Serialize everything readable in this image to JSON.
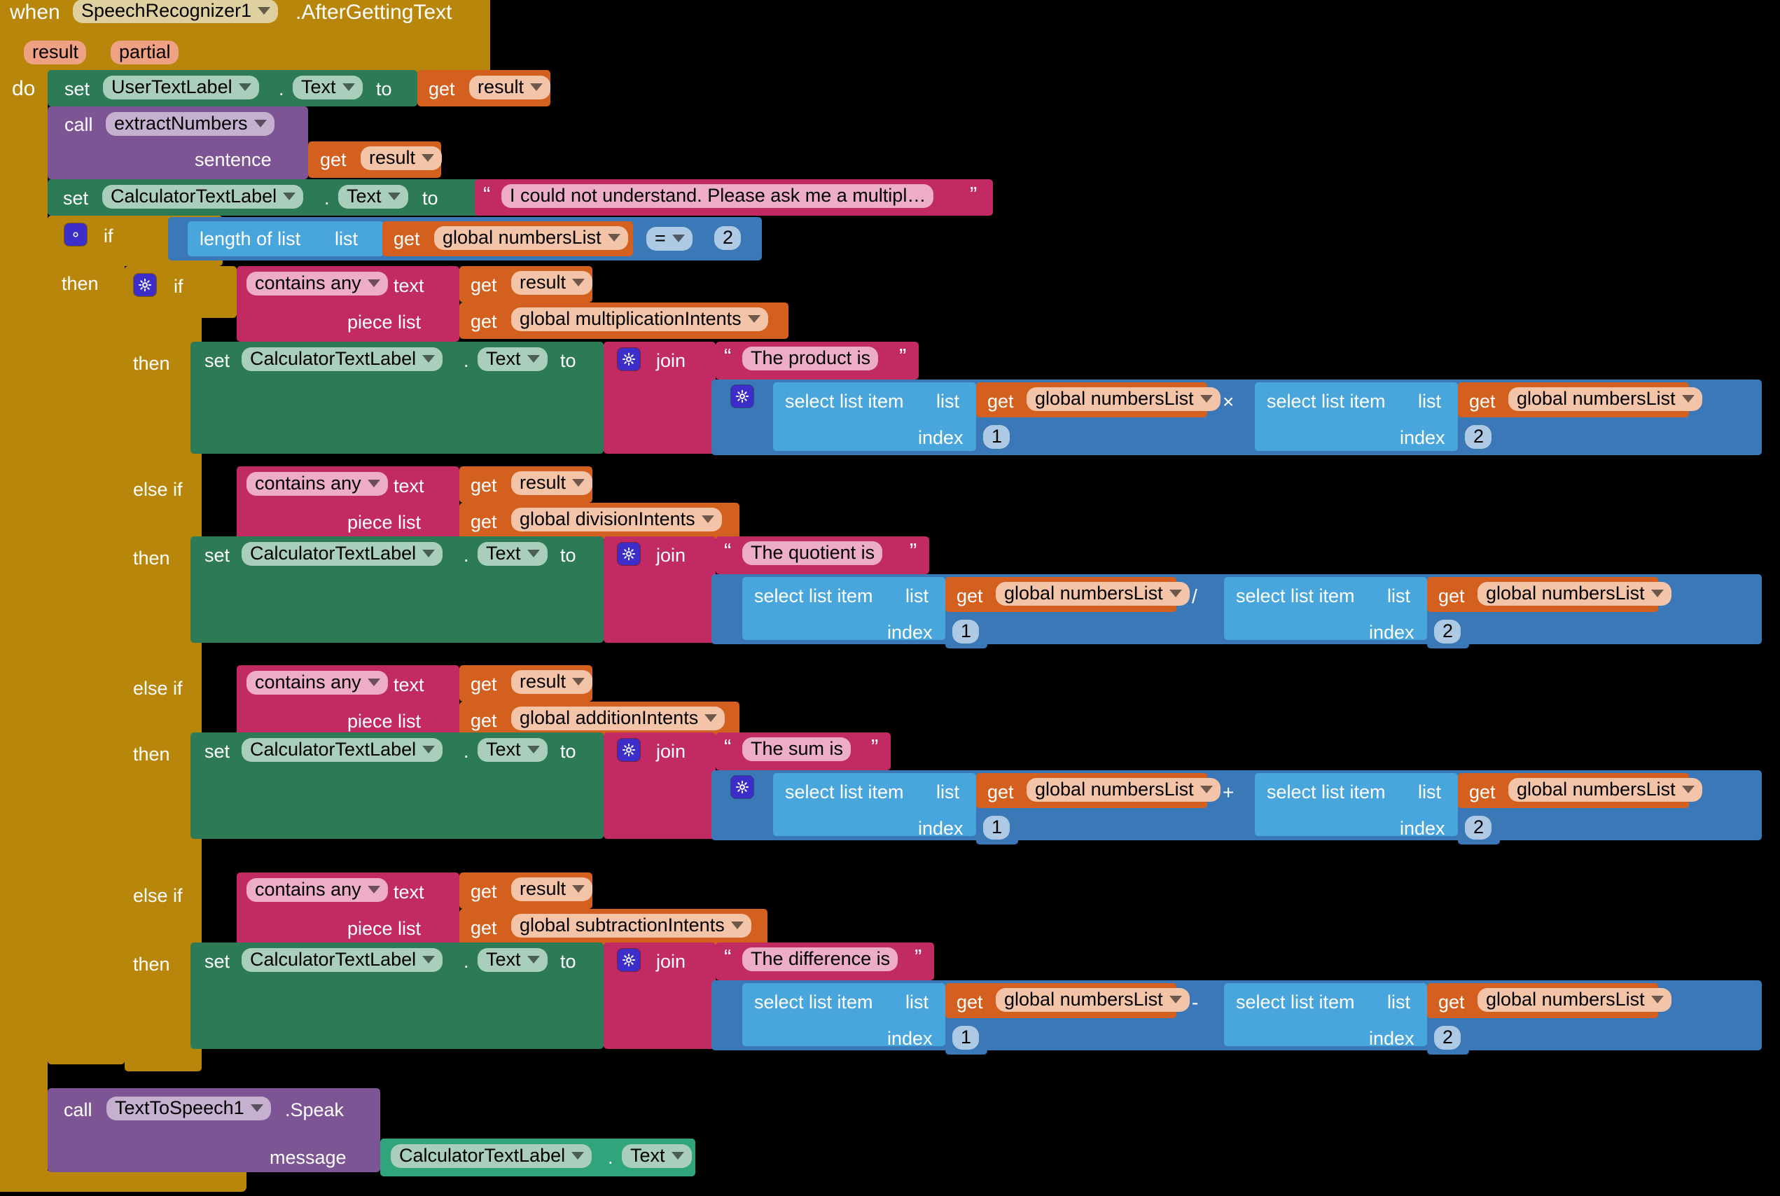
{
  "app": "MIT App Inventor Blocks Editor",
  "event": {
    "when": "when",
    "component": "SpeechRecognizer1",
    "method": ".AfterGettingText",
    "params": [
      "result",
      "partial"
    ],
    "do_label": "do"
  },
  "statements": {
    "set_label": "set",
    "call_label": "call",
    "to_label": "to",
    "dot": ".",
    "get_label": "get",
    "user_text_label": "UserTextLabel",
    "calculator_text_label": "CalculatorTextLabel",
    "text_prop": "Text",
    "proc_name": "extractNumbers",
    "sentence_label": "sentence",
    "result_var": "result",
    "tts_component": "TextToSpeech1",
    "tts_method": ".Speak",
    "message_label": "message"
  },
  "fallback_text": "I could not understand.  Please ask me a multipl…",
  "control": {
    "if": "if",
    "then": "then",
    "else_if": "else if"
  },
  "outer_condition": {
    "length_of_list": "length of list",
    "list_label": "list",
    "variable": "global numbersList",
    "operator": "=",
    "value": "2"
  },
  "list_ops": {
    "select": "select list item",
    "list_label": "list",
    "index_label": "index",
    "numbers_list": "global numbersList"
  },
  "text_ops": {
    "contains_any": "contains any",
    "text_label": "text",
    "piece_list_label": "piece list",
    "join": "join",
    "open_quote": "“",
    "close_quote": "”"
  },
  "branches": [
    {
      "id": "multiplication",
      "if_kind": "if",
      "intents_var": "global multiplicationIntents",
      "phrase": "The product is",
      "operator": "×",
      "left_index": "1",
      "right_index": "2",
      "left_gear": true,
      "right_gear": false
    },
    {
      "id": "division",
      "if_kind": "else if",
      "intents_var": "global divisionIntents",
      "phrase": "The quotient is",
      "operator": "/",
      "left_index": "1",
      "right_index": "2",
      "left_gear": false,
      "right_gear": false
    },
    {
      "id": "addition",
      "if_kind": "else if",
      "intents_var": "global additionIntents",
      "phrase": "The sum is",
      "operator": "+",
      "left_index": "1",
      "right_index": "2",
      "left_gear": true,
      "right_gear": false
    },
    {
      "id": "subtraction",
      "if_kind": "else if",
      "intents_var": "global subtractionIntents",
      "phrase": "The difference is",
      "operator": "-",
      "left_index": "1",
      "right_index": "2",
      "left_gear": false,
      "right_gear": false
    }
  ],
  "colors": {
    "event": "#b8860b",
    "control": "#b8860b",
    "component_set": "#2c7a56",
    "procedure": "#7d5494",
    "variable": "#d4601f",
    "text": "#c12a63",
    "math": "#3b78b7",
    "list": "#49a6dc",
    "parameter": "#efa183",
    "mutator": "#3d2ec9",
    "background": "#000000"
  }
}
